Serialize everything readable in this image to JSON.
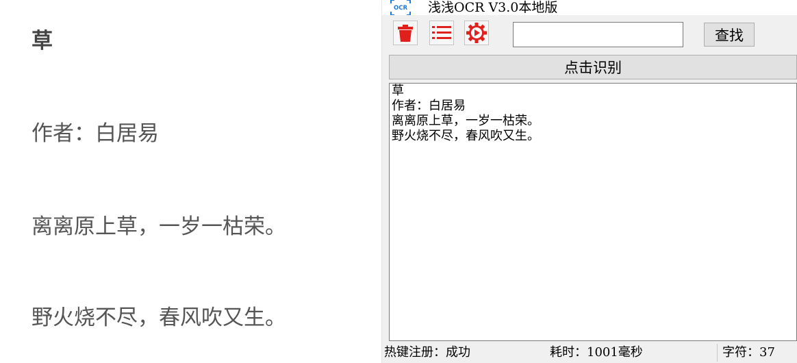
{
  "document": {
    "title": "草",
    "lines": [
      "作者：白居易",
      "离离原上草，一岁一枯荣。",
      "野火烧不尽，春风吹又生。"
    ]
  },
  "app": {
    "logo_text": "OCR",
    "title": "浅浅OCR V3.0本地版",
    "toolbar": {
      "clear_icon": "trash-icon",
      "list_icon": "list-icon",
      "settings_icon": "gear-icon",
      "search_value": "",
      "search_label": "查找"
    },
    "recognize_label": "点击识别",
    "result_lines": [
      "草",
      "作者：白居易",
      "离离原上草，一岁一枯荣。",
      "野火烧不尽，春风吹又生。"
    ],
    "status": {
      "hotkey": "热键注册：成功",
      "time": "耗时：1001毫秒",
      "chars": "字符：37"
    },
    "colors": {
      "icon_red": "#e0201c",
      "logo_blue": "#1e78d4"
    }
  }
}
